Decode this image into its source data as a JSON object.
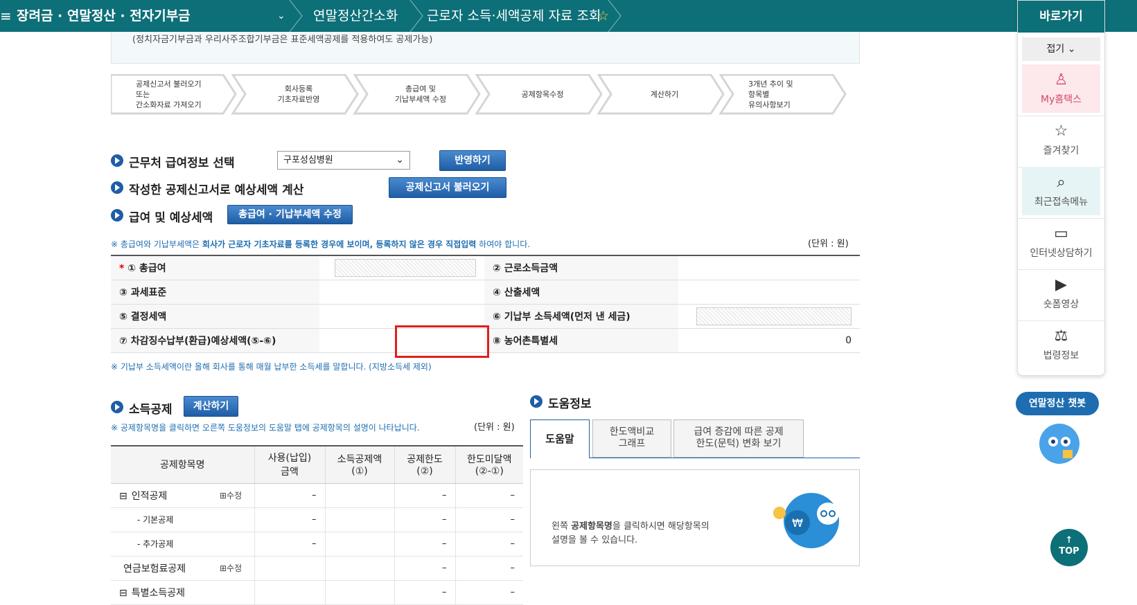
{
  "breadcrumb": {
    "menu_icon": "hamburger-icon",
    "section": "장려금 · 연말정산 · 전자기부금",
    "sub": "연말정산간소화",
    "page": "근로자 소득·세액공제 자료 조회",
    "star": "star-icon"
  },
  "notice": "(정치자금기부금과 우리사주조합기부금은 표준세액공제를 적용하여도 공제가능)",
  "steps": [
    {
      "lines": [
        "공제신고서 불러오기",
        "또는",
        "간소화자료 가져오기"
      ]
    },
    {
      "lines": [
        "회사등록",
        "기초자료반영"
      ]
    },
    {
      "lines": [
        "총급여 및",
        "기납부세액 수정"
      ]
    },
    {
      "lines": [
        "공제항목수정"
      ]
    },
    {
      "lines": [
        "계산하기"
      ]
    },
    {
      "lines": [
        "3개년 추이 및",
        "항목별",
        "유의사항보기"
      ]
    }
  ],
  "section1": {
    "title": "근무처 급여정보 선택",
    "select_value": "구포성심병원",
    "apply_button": "반영하기"
  },
  "section2": {
    "title": "작성한 공제신고서로 예상세액 계산",
    "load_button": "공제신고서 불러오기"
  },
  "section3": {
    "title": "급여 및 예상세액",
    "edit_button": "총급여 · 기납부세액 수정"
  },
  "salary_note_prefix": "※ 총급여와 기납부세액은 ",
  "salary_note_bold": "회사가 근로자 기초자료를 등록한 경우에 보이며, 등록하지 않은 경우 직접입력",
  "salary_note_suffix": " 하여야 합니다.",
  "unit": "(단위 : 원)",
  "salary_rows": [
    {
      "l1": "① 총급여",
      "required": "*",
      "l2": "② 근로소득금액"
    },
    {
      "l1": "③ 과세표준",
      "l2": "④ 산출세액"
    },
    {
      "l1": "⑤ 결정세액",
      "l2": "⑥ 기납부 소득세액(먼저 낸 세금)"
    },
    {
      "l1": "⑦ 차감징수납부(환급)예상세액(⑤-⑥)",
      "l2": "⑧ 농어촌특별세",
      "v2": "0"
    }
  ],
  "withheld_note": "※ 기납부 소득세액이란 올해 회사를 통해 매월 납부한 소득세를 말합니다. (지방소득세 제외)",
  "deduction": {
    "title": "소득공제",
    "calc_button": "계산하기",
    "note": "※ 공제항목명을 클릭하면 오른쪽 도움정보의 도움말 탭에 공제항목의 설명이 나타납니다.",
    "unit": "(단위 : 원)",
    "headers": [
      "공제항목명",
      "사용(납입)\n금액",
      "소득공제액\n(①)",
      "공제한도\n(②)",
      "한도미달액\n(②-①)"
    ],
    "rows": [
      {
        "toggle": "⊟",
        "name": "인적공제",
        "edit": "⊞수정",
        "used": "–",
        "limit": "–",
        "short": "–"
      },
      {
        "toggle": "",
        "name": "- 기본공제",
        "edit": "",
        "used": "–",
        "limit": "–",
        "short": "–"
      },
      {
        "toggle": "",
        "name": "- 추가공제",
        "edit": "",
        "used": "–",
        "limit": "–",
        "short": "–"
      },
      {
        "toggle": "",
        "name": "연금보험료공제",
        "edit": "⊞수정",
        "used": "",
        "limit": "–",
        "short": "–"
      },
      {
        "toggle": "⊟",
        "name": "특별소득공제",
        "edit": "",
        "used": "",
        "limit": "–",
        "short": "–"
      }
    ]
  },
  "help": {
    "title": "도움정보",
    "tabs": [
      "도움말",
      "한도액비교\n그래프",
      "급여 증감에 따른 공제\n한도(문턱) 변화 보기"
    ],
    "text_prefix": "왼쪽 ",
    "text_bold": "공제항목명",
    "text_suffix": "을 클릭하시면 해당항목의\n설명을 볼 수 있습니다."
  },
  "quick": {
    "title": "바로가기",
    "collapse": "접기",
    "items": [
      {
        "icon": "person-icon",
        "label": "My홈택스"
      },
      {
        "icon": "star-outline-icon",
        "label": "즐겨찾기"
      },
      {
        "icon": "recent-search-icon",
        "label": "최근접속메뉴"
      },
      {
        "icon": "monitor-chat-icon",
        "label": "인터넷상담하기"
      },
      {
        "icon": "play-icon",
        "label": "숏폼영상"
      },
      {
        "icon": "gavel-icon",
        "label": "법령정보"
      }
    ]
  },
  "chatbot": "연말정산 챗봇",
  "top_button": "TOP",
  "colors": {
    "topbar": "#0d6f78",
    "button": "#1f5ea6",
    "note": "#1d6db0",
    "highlight": "#e0201b"
  }
}
